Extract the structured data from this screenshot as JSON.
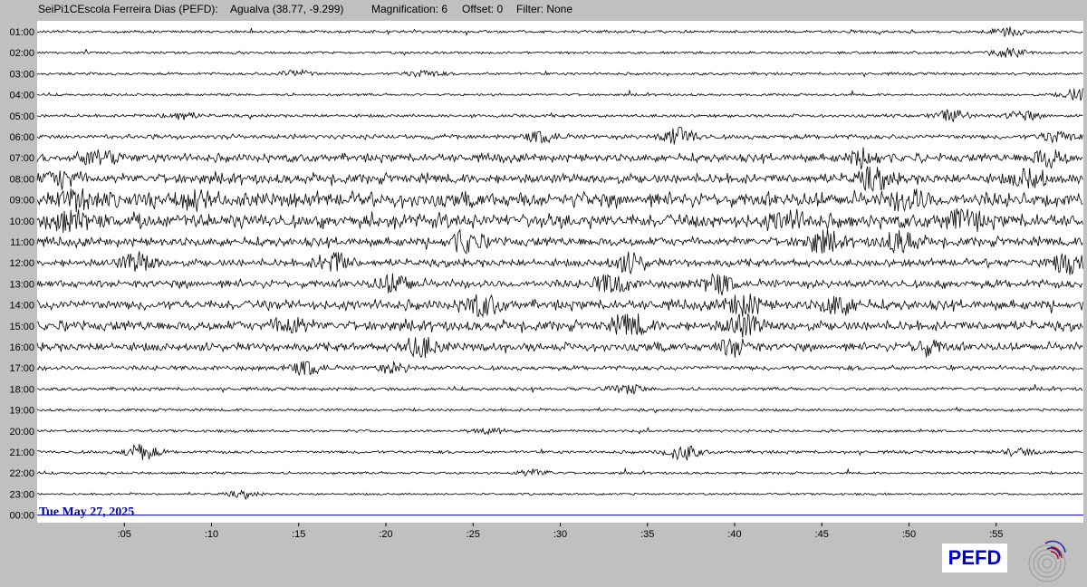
{
  "header": {
    "station": "SeiPi1CEscola Ferreira Dias (PEFD):",
    "location": "Agualva (38.77, -9.299)",
    "magnification": "Magnification: 6",
    "offset": "Offset: 0",
    "filter": "Filter: None"
  },
  "date_label": "Tue May 27, 2025",
  "logo_text": "PEFD",
  "colors": {
    "background": "#c0c0c0",
    "plot_background": "#ffffff",
    "trace": "#000000",
    "current_line": "#0000c8",
    "date_text": "#0000b0",
    "logo_text": "#0000c8"
  },
  "chart_data": {
    "type": "line",
    "title": "",
    "xlabel": "",
    "ylabel": "",
    "x_range_minutes": [
      0,
      60
    ],
    "x_ticks": [
      {
        "minute": 5,
        "label": ":05"
      },
      {
        "minute": 10,
        "label": ":10"
      },
      {
        "minute": 15,
        "label": ":15"
      },
      {
        "minute": 20,
        "label": ":20"
      },
      {
        "minute": 25,
        "label": ":25"
      },
      {
        "minute": 30,
        "label": ":30"
      },
      {
        "minute": 35,
        "label": ":35"
      },
      {
        "minute": 40,
        "label": ":40"
      },
      {
        "minute": 45,
        "label": ":45"
      },
      {
        "minute": 50,
        "label": ":50"
      },
      {
        "minute": 55,
        "label": ":55"
      }
    ],
    "hours": [
      {
        "label": "01:00",
        "activity": 0.1,
        "bursts": [
          {
            "minute": 55.5,
            "amp": 0.35
          }
        ]
      },
      {
        "label": "02:00",
        "activity": 0.08,
        "bursts": [
          {
            "minute": 55.8,
            "amp": 0.45
          }
        ]
      },
      {
        "label": "03:00",
        "activity": 0.1,
        "bursts": [
          {
            "minute": 14.8,
            "amp": 0.3
          },
          {
            "minute": 22.2,
            "amp": 0.3
          }
        ]
      },
      {
        "label": "04:00",
        "activity": 0.08,
        "bursts": [
          {
            "minute": 59.8,
            "amp": 0.6
          }
        ]
      },
      {
        "label": "05:00",
        "activity": 0.12,
        "bursts": [
          {
            "minute": 8.2,
            "amp": 0.35
          },
          {
            "minute": 52.5,
            "amp": 0.5
          },
          {
            "minute": 56.5,
            "amp": 0.4
          }
        ]
      },
      {
        "label": "06:00",
        "activity": 0.22,
        "bursts": [
          {
            "minute": 36.8,
            "amp": 0.8
          },
          {
            "minute": 29.0,
            "amp": 0.5
          },
          {
            "minute": 58.5,
            "amp": 0.5
          }
        ]
      },
      {
        "label": "07:00",
        "activity": 0.45,
        "bursts": [
          {
            "minute": 3.5,
            "amp": 0.7
          },
          {
            "minute": 47.5,
            "amp": 0.7
          },
          {
            "minute": 58.0,
            "amp": 0.7
          }
        ]
      },
      {
        "label": "08:00",
        "activity": 0.55,
        "bursts": [
          {
            "minute": 1.5,
            "amp": 0.7
          },
          {
            "minute": 48.0,
            "amp": 0.9
          },
          {
            "minute": 57.0,
            "amp": 0.8
          }
        ]
      },
      {
        "label": "09:00",
        "activity": 0.85,
        "bursts": [
          {
            "minute": 2.5,
            "amp": 1.0
          },
          {
            "minute": 9.0,
            "amp": 0.8
          },
          {
            "minute": 50.0,
            "amp": 0.9
          }
        ]
      },
      {
        "label": "10:00",
        "activity": 0.8,
        "bursts": [
          {
            "minute": 2.0,
            "amp": 0.9
          },
          {
            "minute": 43.0,
            "amp": 0.9
          },
          {
            "minute": 53.0,
            "amp": 0.9
          }
        ]
      },
      {
        "label": "11:00",
        "activity": 0.5,
        "bursts": [
          {
            "minute": 24.5,
            "amp": 0.9
          },
          {
            "minute": 45.0,
            "amp": 0.9
          },
          {
            "minute": 49.5,
            "amp": 0.9
          }
        ]
      },
      {
        "label": "12:00",
        "activity": 0.4,
        "bursts": [
          {
            "minute": 5.8,
            "amp": 0.8
          },
          {
            "minute": 17.0,
            "amp": 0.9
          },
          {
            "minute": 34.0,
            "amp": 0.8
          },
          {
            "minute": 59.0,
            "amp": 0.8
          }
        ]
      },
      {
        "label": "13:00",
        "activity": 0.45,
        "bursts": [
          {
            "minute": 20.5,
            "amp": 0.8
          },
          {
            "minute": 33.0,
            "amp": 0.9
          },
          {
            "minute": 39.0,
            "amp": 0.8
          }
        ]
      },
      {
        "label": "14:00",
        "activity": 0.55,
        "bursts": [
          {
            "minute": 25.5,
            "amp": 1.0
          },
          {
            "minute": 40.5,
            "amp": 0.9
          },
          {
            "minute": 46.0,
            "amp": 0.8
          }
        ]
      },
      {
        "label": "15:00",
        "activity": 0.55,
        "bursts": [
          {
            "minute": 14.5,
            "amp": 0.7
          },
          {
            "minute": 34.0,
            "amp": 0.9
          },
          {
            "minute": 40.5,
            "amp": 1.0
          }
        ]
      },
      {
        "label": "16:00",
        "activity": 0.45,
        "bursts": [
          {
            "minute": 22.0,
            "amp": 0.8
          },
          {
            "minute": 40.0,
            "amp": 0.7
          },
          {
            "minute": 51.0,
            "amp": 0.6
          }
        ]
      },
      {
        "label": "17:00",
        "activity": 0.22,
        "bursts": [
          {
            "minute": 15.5,
            "amp": 0.6
          },
          {
            "minute": 20.5,
            "amp": 0.4
          }
        ]
      },
      {
        "label": "18:00",
        "activity": 0.14,
        "bursts": [
          {
            "minute": 33.8,
            "amp": 0.4
          }
        ]
      },
      {
        "label": "19:00",
        "activity": 0.1,
        "bursts": []
      },
      {
        "label": "20:00",
        "activity": 0.1,
        "bursts": [
          {
            "minute": 26.0,
            "amp": 0.25
          }
        ]
      },
      {
        "label": "21:00",
        "activity": 0.12,
        "bursts": [
          {
            "minute": 6.0,
            "amp": 0.7
          },
          {
            "minute": 37.0,
            "amp": 0.7
          },
          {
            "minute": 56.3,
            "amp": 0.3
          }
        ]
      },
      {
        "label": "22:00",
        "activity": 0.08,
        "bursts": [
          {
            "minute": 28.5,
            "amp": 0.3
          }
        ]
      },
      {
        "label": "23:00",
        "activity": 0.06,
        "bursts": [
          {
            "minute": 11.8,
            "amp": 0.25
          }
        ]
      },
      {
        "label": "00:00",
        "activity": 0.0,
        "bursts": [],
        "current": true
      }
    ]
  }
}
